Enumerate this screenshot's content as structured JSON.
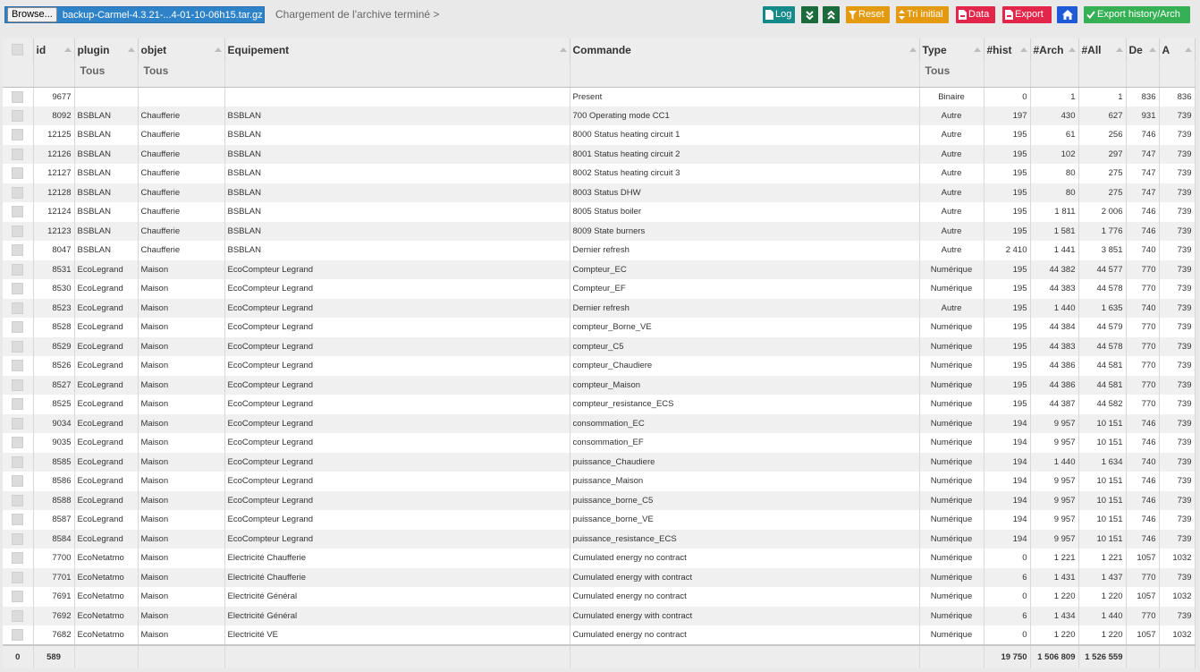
{
  "toolbar": {
    "browse_label": "Browse...",
    "file_name": "backup-Carmel-4.3.21-...4-01-10-06h15.tar.gz",
    "status": "Chargement de l'archive terminé >",
    "log_label": "Log",
    "expand_icon": "chevrons-down-icon",
    "collapse_icon": "chevrons-up-icon",
    "reset_label": "Reset",
    "tri_label": "Tri initial",
    "data_label": "Data",
    "export_label": "Export",
    "home_icon": "home-icon",
    "export_history_label": "Export history/Arch"
  },
  "colors": {
    "teal": "#148a8a",
    "dark_green": "#1d6b3c",
    "orange": "#e39a0e",
    "red": "#e4254a",
    "blue": "#1f5ad6",
    "green": "#35b054",
    "browse_blue": "#2e82c8"
  },
  "table": {
    "headers": {
      "id": "id",
      "plugin": "plugin",
      "objet": "objet",
      "equipement": "Equipement",
      "commande": "Commande",
      "type": "Type",
      "hist": "#hist",
      "arch": "#Arch",
      "all": "#All",
      "de": "De",
      "a": "A"
    },
    "filters": {
      "plugin": "Tous",
      "objet": "Tous",
      "type": "Tous"
    },
    "rows": [
      {
        "id": "9677",
        "plugin": "",
        "objet": "",
        "equipement": "",
        "commande": "Present",
        "type": "Binaire",
        "hist": "0",
        "arch": "1",
        "all": "1",
        "de": "836",
        "a": "836"
      },
      {
        "id": "8092",
        "plugin": "BSBLAN",
        "objet": "Chaufferie",
        "equipement": "BSBLAN",
        "commande": "700 Operating mode CC1",
        "type": "Autre",
        "hist": "197",
        "arch": "430",
        "all": "627",
        "de": "931",
        "a": "739"
      },
      {
        "id": "12125",
        "plugin": "BSBLAN",
        "objet": "Chaufferie",
        "equipement": "BSBLAN",
        "commande": "8000 Status heating circuit 1",
        "type": "Autre",
        "hist": "195",
        "arch": "61",
        "all": "256",
        "de": "746",
        "a": "739"
      },
      {
        "id": "12126",
        "plugin": "BSBLAN",
        "objet": "Chaufferie",
        "equipement": "BSBLAN",
        "commande": "8001 Status heating circuit 2",
        "type": "Autre",
        "hist": "195",
        "arch": "102",
        "all": "297",
        "de": "747",
        "a": "739"
      },
      {
        "id": "12127",
        "plugin": "BSBLAN",
        "objet": "Chaufferie",
        "equipement": "BSBLAN",
        "commande": "8002 Status heating circuit 3",
        "type": "Autre",
        "hist": "195",
        "arch": "80",
        "all": "275",
        "de": "747",
        "a": "739"
      },
      {
        "id": "12128",
        "plugin": "BSBLAN",
        "objet": "Chaufferie",
        "equipement": "BSBLAN",
        "commande": "8003 Status DHW",
        "type": "Autre",
        "hist": "195",
        "arch": "80",
        "all": "275",
        "de": "747",
        "a": "739"
      },
      {
        "id": "12124",
        "plugin": "BSBLAN",
        "objet": "Chaufferie",
        "equipement": "BSBLAN",
        "commande": "8005 Status boiler",
        "type": "Autre",
        "hist": "195",
        "arch": "1 811",
        "all": "2 006",
        "de": "746",
        "a": "739"
      },
      {
        "id": "12123",
        "plugin": "BSBLAN",
        "objet": "Chaufferie",
        "equipement": "BSBLAN",
        "commande": "8009 State burners",
        "type": "Autre",
        "hist": "195",
        "arch": "1 581",
        "all": "1 776",
        "de": "746",
        "a": "739"
      },
      {
        "id": "8047",
        "plugin": "BSBLAN",
        "objet": "Chaufferie",
        "equipement": "BSBLAN",
        "commande": "Dernier refresh",
        "type": "Autre",
        "hist": "2 410",
        "arch": "1 441",
        "all": "3 851",
        "de": "740",
        "a": "739"
      },
      {
        "id": "8531",
        "plugin": "EcoLegrand",
        "objet": "Maison",
        "equipement": "EcoCompteur Legrand",
        "commande": "Compteur_EC",
        "type": "Numérique",
        "hist": "195",
        "arch": "44 382",
        "all": "44 577",
        "de": "770",
        "a": "739"
      },
      {
        "id": "8530",
        "plugin": "EcoLegrand",
        "objet": "Maison",
        "equipement": "EcoCompteur Legrand",
        "commande": "Compteur_EF",
        "type": "Numérique",
        "hist": "195",
        "arch": "44 383",
        "all": "44 578",
        "de": "770",
        "a": "739"
      },
      {
        "id": "8523",
        "plugin": "EcoLegrand",
        "objet": "Maison",
        "equipement": "EcoCompteur Legrand",
        "commande": "Dernier refresh",
        "type": "Autre",
        "hist": "195",
        "arch": "1 440",
        "all": "1 635",
        "de": "740",
        "a": "739"
      },
      {
        "id": "8528",
        "plugin": "EcoLegrand",
        "objet": "Maison",
        "equipement": "EcoCompteur Legrand",
        "commande": "compteur_Borne_VE",
        "type": "Numérique",
        "hist": "195",
        "arch": "44 384",
        "all": "44 579",
        "de": "770",
        "a": "739"
      },
      {
        "id": "8529",
        "plugin": "EcoLegrand",
        "objet": "Maison",
        "equipement": "EcoCompteur Legrand",
        "commande": "compteur_C5",
        "type": "Numérique",
        "hist": "195",
        "arch": "44 383",
        "all": "44 578",
        "de": "770",
        "a": "739"
      },
      {
        "id": "8526",
        "plugin": "EcoLegrand",
        "objet": "Maison",
        "equipement": "EcoCompteur Legrand",
        "commande": "compteur_Chaudiere",
        "type": "Numérique",
        "hist": "195",
        "arch": "44 386",
        "all": "44 581",
        "de": "770",
        "a": "739"
      },
      {
        "id": "8527",
        "plugin": "EcoLegrand",
        "objet": "Maison",
        "equipement": "EcoCompteur Legrand",
        "commande": "compteur_Maison",
        "type": "Numérique",
        "hist": "195",
        "arch": "44 386",
        "all": "44 581",
        "de": "770",
        "a": "739"
      },
      {
        "id": "8525",
        "plugin": "EcoLegrand",
        "objet": "Maison",
        "equipement": "EcoCompteur Legrand",
        "commande": "compteur_resistance_ECS",
        "type": "Numérique",
        "hist": "195",
        "arch": "44 387",
        "all": "44 582",
        "de": "770",
        "a": "739"
      },
      {
        "id": "9034",
        "plugin": "EcoLegrand",
        "objet": "Maison",
        "equipement": "EcoCompteur Legrand",
        "commande": "consommation_EC",
        "type": "Numérique",
        "hist": "194",
        "arch": "9 957",
        "all": "10 151",
        "de": "746",
        "a": "739"
      },
      {
        "id": "9035",
        "plugin": "EcoLegrand",
        "objet": "Maison",
        "equipement": "EcoCompteur Legrand",
        "commande": "consommation_EF",
        "type": "Numérique",
        "hist": "194",
        "arch": "9 957",
        "all": "10 151",
        "de": "746",
        "a": "739"
      },
      {
        "id": "8585",
        "plugin": "EcoLegrand",
        "objet": "Maison",
        "equipement": "EcoCompteur Legrand",
        "commande": "puissance_Chaudiere",
        "type": "Numérique",
        "hist": "194",
        "arch": "1 440",
        "all": "1 634",
        "de": "740",
        "a": "739"
      },
      {
        "id": "8586",
        "plugin": "EcoLegrand",
        "objet": "Maison",
        "equipement": "EcoCompteur Legrand",
        "commande": "puissance_Maison",
        "type": "Numérique",
        "hist": "194",
        "arch": "9 957",
        "all": "10 151",
        "de": "746",
        "a": "739"
      },
      {
        "id": "8588",
        "plugin": "EcoLegrand",
        "objet": "Maison",
        "equipement": "EcoCompteur Legrand",
        "commande": "puissance_borne_C5",
        "type": "Numérique",
        "hist": "194",
        "arch": "9 957",
        "all": "10 151",
        "de": "746",
        "a": "739"
      },
      {
        "id": "8587",
        "plugin": "EcoLegrand",
        "objet": "Maison",
        "equipement": "EcoCompteur Legrand",
        "commande": "puissance_borne_VE",
        "type": "Numérique",
        "hist": "194",
        "arch": "9 957",
        "all": "10 151",
        "de": "746",
        "a": "739"
      },
      {
        "id": "8584",
        "plugin": "EcoLegrand",
        "objet": "Maison",
        "equipement": "EcoCompteur Legrand",
        "commande": "puissance_resistance_ECS",
        "type": "Numérique",
        "hist": "194",
        "arch": "9 957",
        "all": "10 151",
        "de": "746",
        "a": "739"
      },
      {
        "id": "7700",
        "plugin": "EcoNetatmo",
        "objet": "Maison",
        "equipement": "Electricité Chaufferie",
        "commande": "Cumulated energy no contract",
        "type": "Numérique",
        "hist": "0",
        "arch": "1 221",
        "all": "1 221",
        "de": "1057",
        "a": "1032"
      },
      {
        "id": "7701",
        "plugin": "EcoNetatmo",
        "objet": "Maison",
        "equipement": "Electricité Chaufferie",
        "commande": "Cumulated energy with contract",
        "type": "Numérique",
        "hist": "6",
        "arch": "1 431",
        "all": "1 437",
        "de": "770",
        "a": "739"
      },
      {
        "id": "7691",
        "plugin": "EcoNetatmo",
        "objet": "Maison",
        "equipement": "Electricité Général",
        "commande": "Cumulated energy no contract",
        "type": "Numérique",
        "hist": "0",
        "arch": "1 220",
        "all": "1 220",
        "de": "1057",
        "a": "1032"
      },
      {
        "id": "7692",
        "plugin": "EcoNetatmo",
        "objet": "Maison",
        "equipement": "Electricité Général",
        "commande": "Cumulated energy with contract",
        "type": "Numérique",
        "hist": "6",
        "arch": "1 434",
        "all": "1 440",
        "de": "770",
        "a": "739"
      },
      {
        "id": "7682",
        "plugin": "EcoNetatmo",
        "objet": "Maison",
        "equipement": "Electricité VE",
        "commande": "Cumulated energy no contract",
        "type": "Numérique",
        "hist": "0",
        "arch": "1 220",
        "all": "1 220",
        "de": "1057",
        "a": "1032"
      }
    ],
    "footer": {
      "selected": "0",
      "count": "589",
      "hist": "19 750",
      "arch": "1 506 809",
      "all": "1 526 559"
    }
  }
}
